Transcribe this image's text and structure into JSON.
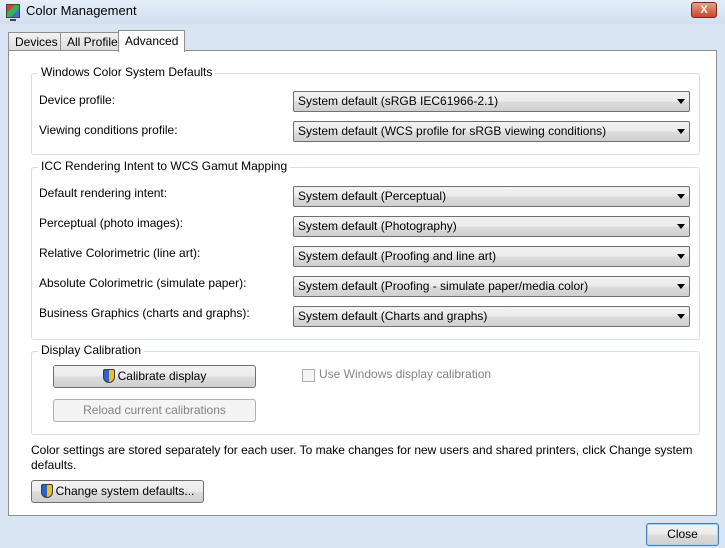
{
  "window": {
    "title": "Color Management",
    "close_glyph": "X"
  },
  "tabs": [
    {
      "label": "Devices",
      "active": false
    },
    {
      "label": "All Profiles",
      "active": false
    },
    {
      "label": "Advanced",
      "active": true
    }
  ],
  "wcs_defaults": {
    "title": "Windows Color System Defaults",
    "rows": [
      {
        "label": "Device profile:",
        "value": "System default (sRGB IEC61966-2.1)"
      },
      {
        "label": "Viewing conditions profile:",
        "value": "System default (WCS profile for sRGB viewing conditions)"
      }
    ]
  },
  "icc_mapping": {
    "title": "ICC Rendering Intent to WCS Gamut Mapping",
    "rows": [
      {
        "label": "Default rendering intent:",
        "value": "System default (Perceptual)"
      },
      {
        "label": "Perceptual (photo images):",
        "value": "System default (Photography)"
      },
      {
        "label": "Relative Colorimetric (line art):",
        "value": "System default (Proofing and line art)"
      },
      {
        "label": "Absolute Colorimetric (simulate paper):",
        "value": "System default (Proofing - simulate paper/media color)"
      },
      {
        "label": "Business Graphics (charts and graphs):",
        "value": "System default (Charts and graphs)"
      }
    ]
  },
  "calibration": {
    "title": "Display Calibration",
    "calibrate_button": "Calibrate display",
    "reload_button": "Reload current calibrations",
    "use_windows_calibration": "Use Windows display calibration",
    "use_windows_calibration_checked": false
  },
  "footer": {
    "note": "Color settings are stored separately for each user. To make changes for new users and shared printers, click Change system defaults.",
    "change_defaults_button": "Change system defaults...",
    "close_button": "Close"
  }
}
